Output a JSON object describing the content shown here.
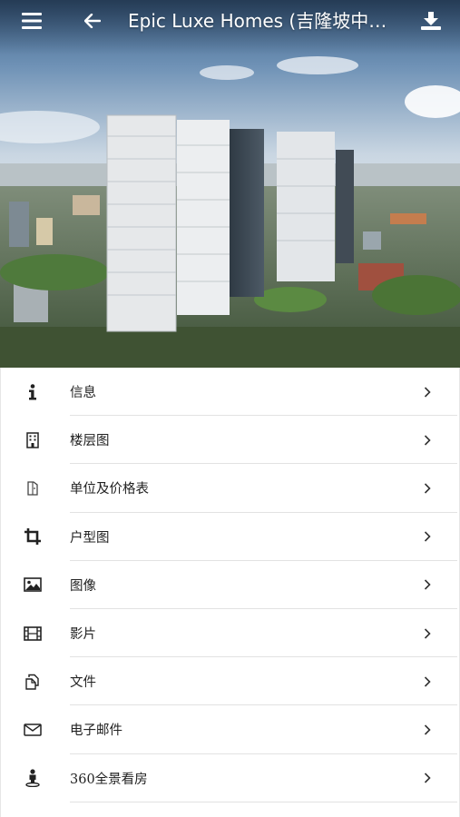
{
  "header": {
    "title": "Epic Luxe Homes (吉隆坡中环 Kuala Lumpur)",
    "menu_icon": "hamburger-menu-icon",
    "back_icon": "arrow-left-icon",
    "download_icon": "download-icon"
  },
  "hero": {
    "image": "city-skyline-towers-photo"
  },
  "menu": {
    "items": [
      {
        "label": "信息",
        "icon": "info-icon"
      },
      {
        "label": "楼层图",
        "icon": "building-icon"
      },
      {
        "label": "单位及价格表",
        "icon": "unit-price-icon"
      },
      {
        "label": "户型图",
        "icon": "crop-icon"
      },
      {
        "label": "图像",
        "icon": "image-icon"
      },
      {
        "label": "影片",
        "icon": "film-icon"
      },
      {
        "label": "文件",
        "icon": "documents-icon"
      },
      {
        "label": "电子邮件",
        "icon": "mail-icon"
      },
      {
        "label": "360全景看房",
        "icon": "street-view-icon"
      }
    ]
  },
  "colors": {
    "icon": "#222222",
    "divider": "#e2e2e2",
    "text": "#222222"
  }
}
